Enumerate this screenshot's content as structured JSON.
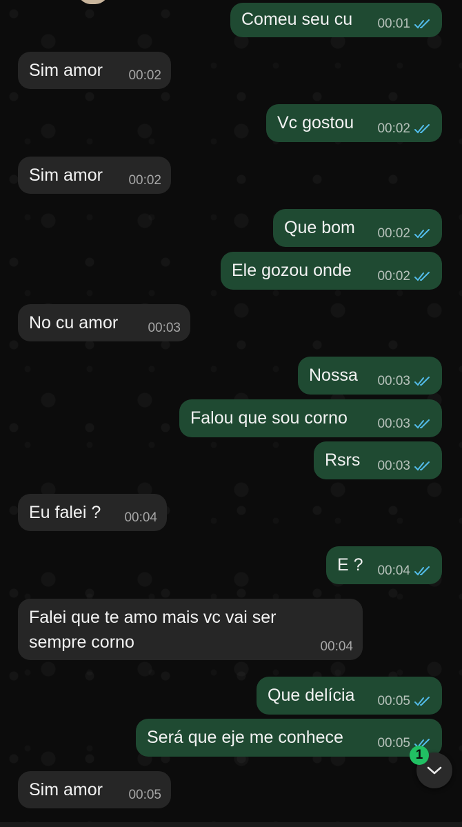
{
  "messages": [
    {
      "dir": "out",
      "text": "Comeu seu cu",
      "time": "00:01",
      "read": true
    },
    {
      "dir": "in",
      "text": "Sim amor",
      "time": "00:02"
    },
    {
      "dir": "out",
      "text": "Vc gostou",
      "time": "00:02",
      "read": true
    },
    {
      "dir": "in",
      "text": "Sim amor",
      "time": "00:02"
    },
    {
      "dir": "out",
      "text": "Que bom",
      "time": "00:02",
      "read": true
    },
    {
      "dir": "out",
      "text": "Ele gozou onde",
      "time": "00:02",
      "read": true
    },
    {
      "dir": "in",
      "text": "No cu amor",
      "time": "00:03"
    },
    {
      "dir": "out",
      "text": "Nossa",
      "time": "00:03",
      "read": true
    },
    {
      "dir": "out",
      "text": "Falou que sou corno",
      "time": "00:03",
      "read": true
    },
    {
      "dir": "out",
      "text": "Rsrs",
      "time": "00:03",
      "read": true
    },
    {
      "dir": "in",
      "text": "Eu falei ?",
      "time": "00:04"
    },
    {
      "dir": "out",
      "text": "E ?",
      "time": "00:04",
      "read": true
    },
    {
      "dir": "in",
      "text": "Falei que te amo mais vc vai ser sempre corno",
      "time": "00:04"
    },
    {
      "dir": "out",
      "text": "Que delícia",
      "time": "00:05",
      "read": true
    },
    {
      "dir": "out",
      "text": "Será que eje me conhece",
      "time": "00:05",
      "read": true
    },
    {
      "dir": "in",
      "text": "Sim amor",
      "time": "00:05"
    }
  ],
  "scroll_button": {
    "unread_count": "1",
    "icon": "chevron-down-icon"
  },
  "colors": {
    "outgoing_bubble": "#1f4a32",
    "incoming_bubble": "#262626",
    "read_ticks": "#53bdeb",
    "badge": "#21c063"
  }
}
